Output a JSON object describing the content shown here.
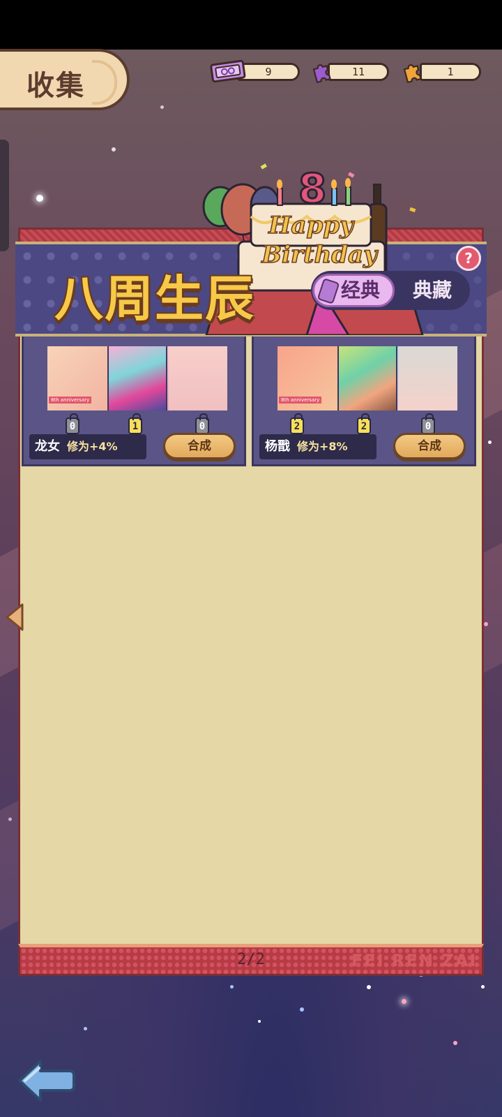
{
  "header": {
    "title": "收集"
  },
  "currencies": [
    {
      "icon": "ticket-icon",
      "value": "9",
      "color": "#b27ad8"
    },
    {
      "icon": "purple-puzzle-icon",
      "value": "11",
      "color": "#9b5bd1"
    },
    {
      "icon": "orange-puzzle-icon",
      "value": "1",
      "color": "#f0a43a"
    }
  ],
  "banner": {
    "title": "八周生辰",
    "help_icon": "?",
    "toggle": {
      "active": "经典",
      "inactive": "典藏"
    },
    "cake": {
      "number": "8",
      "text_line1": "Happy",
      "text_line2": "Birthday"
    }
  },
  "cards": [
    {
      "name": "龙女",
      "bonus": "修为+4%",
      "art_label": "8th anniversary",
      "fragments": [
        "0",
        "1",
        "0"
      ],
      "button": "合成"
    },
    {
      "name": "杨戬",
      "bonus": "修为+8%",
      "art_label": "8th anniversary",
      "fragments": [
        "2",
        "2",
        "0"
      ],
      "button": "合成"
    }
  ],
  "footer": {
    "page_indicator": "2/2",
    "watermark": "FEI REN ZAI"
  },
  "colors": {
    "accent_gold": "#f7c949",
    "panel_bg": "#e5d7a6",
    "panel_border": "#7a2f36",
    "banner_bg": "#4b4884"
  }
}
